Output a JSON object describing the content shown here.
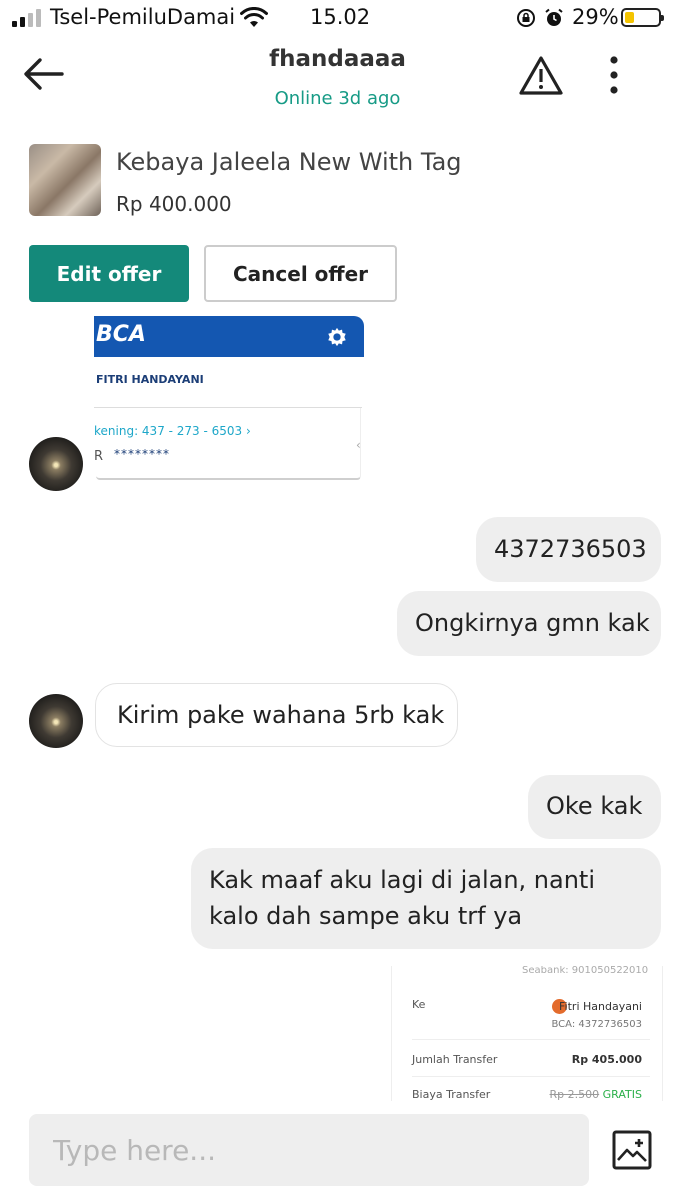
{
  "status_bar": {
    "carrier": "Tsel-PemiluDamai",
    "time": "15.02",
    "battery_percent": "29%",
    "battery_level": 0.29,
    "icons": [
      "signal-icon",
      "wifi-icon",
      "rotation-lock-icon",
      "alarm-icon",
      "battery-icon"
    ]
  },
  "header": {
    "title": "fhandaaaa",
    "subtitle": "Online 3d ago",
    "subtitle_color": "#179b86",
    "icons": [
      "back-arrow-icon",
      "warning-icon",
      "more-vertical-icon"
    ]
  },
  "product": {
    "name": "Kebaya Jaleela New With Tag",
    "price": "Rp 400.000"
  },
  "actions": {
    "edit_offer": "Edit offer",
    "cancel_offer": "Cancel offer",
    "edit_color": "#14897a"
  },
  "bca_screenshot": {
    "logo": "BCA",
    "name": "FITRI HANDAYANI",
    "account": "kening:  437 - 273 - 6503  ›",
    "balance_prefix": "R",
    "balance_masked": "********",
    "brand_color": "#1457b1"
  },
  "messages": [
    {
      "direction": "out",
      "text": "4372736503"
    },
    {
      "direction": "out",
      "text": "Ongkirnya gmn kak"
    },
    {
      "direction": "in",
      "text": "Kirim pake wahana 5rb kak"
    },
    {
      "direction": "out",
      "text": "Oke kak"
    },
    {
      "direction": "out",
      "text": "Kak maaf aku lagi di jalan, nanti kalo dah sampe aku trf ya"
    }
  ],
  "transfer_receipt": {
    "top_partial": "Seabank: 901050522010",
    "to_label": "Ke",
    "to_name": "Fitri Handayani",
    "to_account": "BCA: 4372736503",
    "amount_label": "Jumlah Transfer",
    "amount_value": "Rp 405.000",
    "fee_label": "Biaya Transfer",
    "fee_original": "Rp 2.500",
    "fee_value": "GRATIS"
  },
  "composer": {
    "placeholder": "Type here...",
    "icon": "image-attach-icon"
  }
}
